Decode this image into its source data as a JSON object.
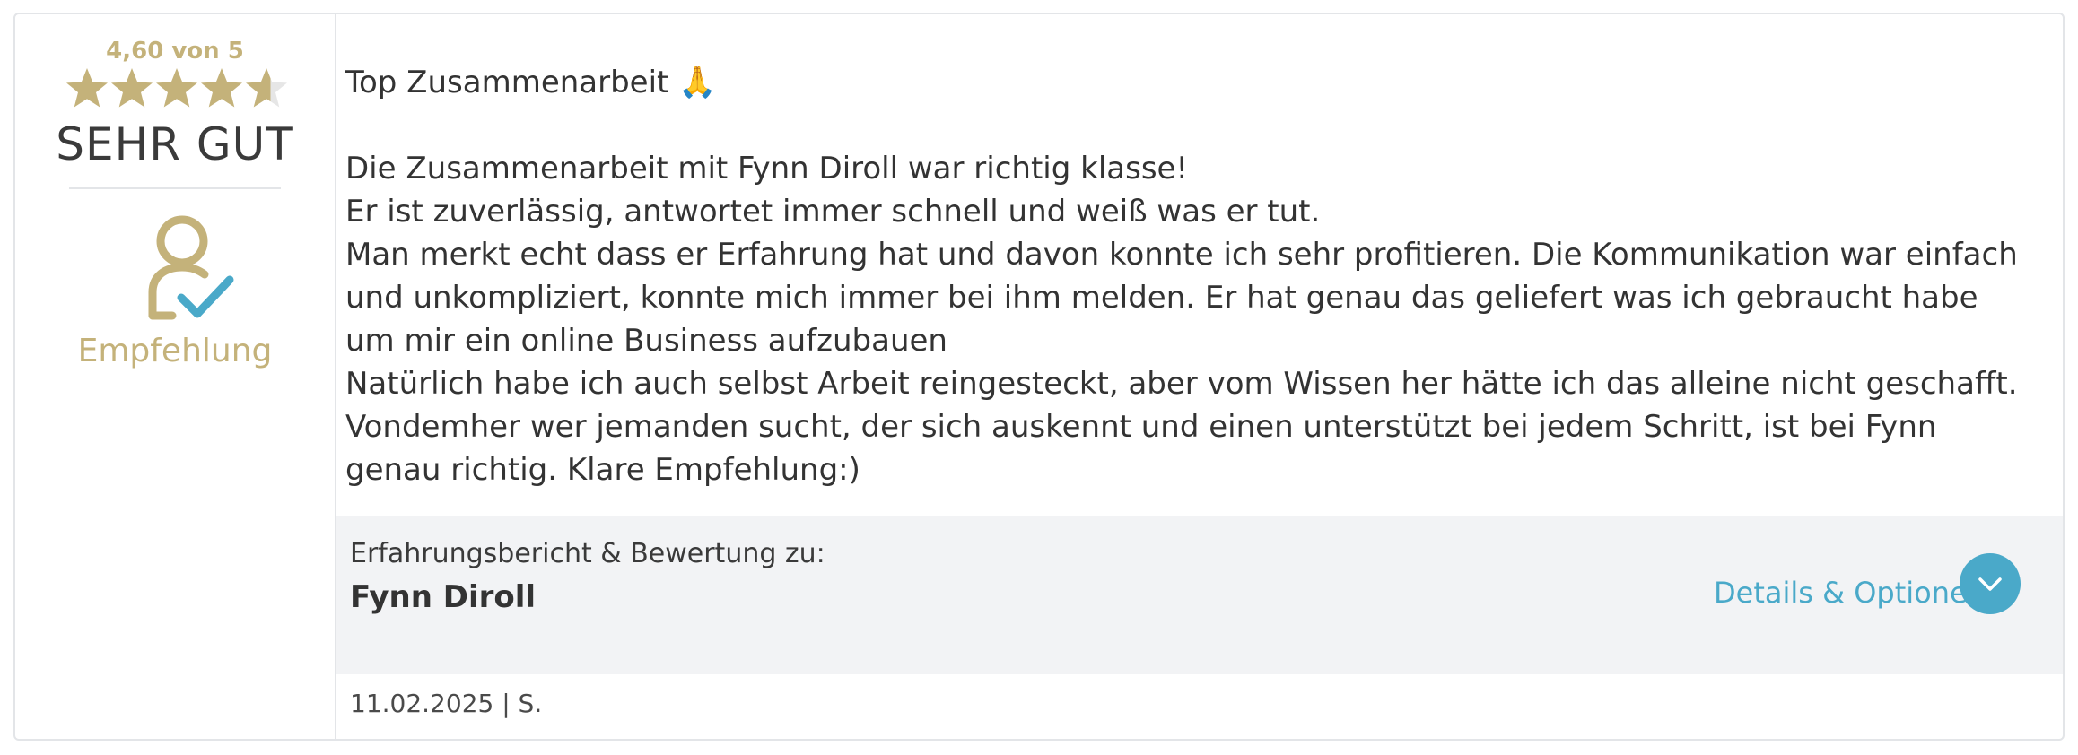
{
  "rating": {
    "score_text": "4,60 von 5",
    "stars": 4.6,
    "max_stars": 5,
    "label": "SEHR GUT",
    "star_color": "#c4b27a",
    "star_empty_color": "#e6e6e6"
  },
  "recommendation": {
    "icon": "person-check-icon",
    "label": "Empfehlung"
  },
  "review": {
    "title": "Top Zusammenarbeit 🙏",
    "lines": [
      "Die Zusammenarbeit mit Fynn Diroll war richtig klasse!",
      "Er ist zuverlässig, antwortet immer schnell und weiß was er tut.",
      "Man merkt echt dass er Erfahrung hat und davon konnte ich sehr profitieren. Die Kommunikation war einfach und unkompliziert, konnte mich immer bei ihm melden. Er hat genau das geliefert was ich gebraucht habe um mir ein online Business aufzubauen",
      "Natürlich habe ich auch selbst Arbeit reingesteckt, aber vom Wissen her hätte ich das alleine nicht geschafft. Vondemher wer jemanden sucht, der sich auskennt und einen unterstützt bei jedem Schritt, ist bei Fynn genau richtig. Klare Empfehlung:)"
    ]
  },
  "footer": {
    "label": "Erfahrungsbericht & Bewertung zu:",
    "name": "Fynn Diroll",
    "details_label": "Details & Optionen",
    "details_icon": "chevron-down-icon",
    "accent_color": "#4aa9c9"
  },
  "meta": {
    "text": "11.02.2025 | S."
  }
}
